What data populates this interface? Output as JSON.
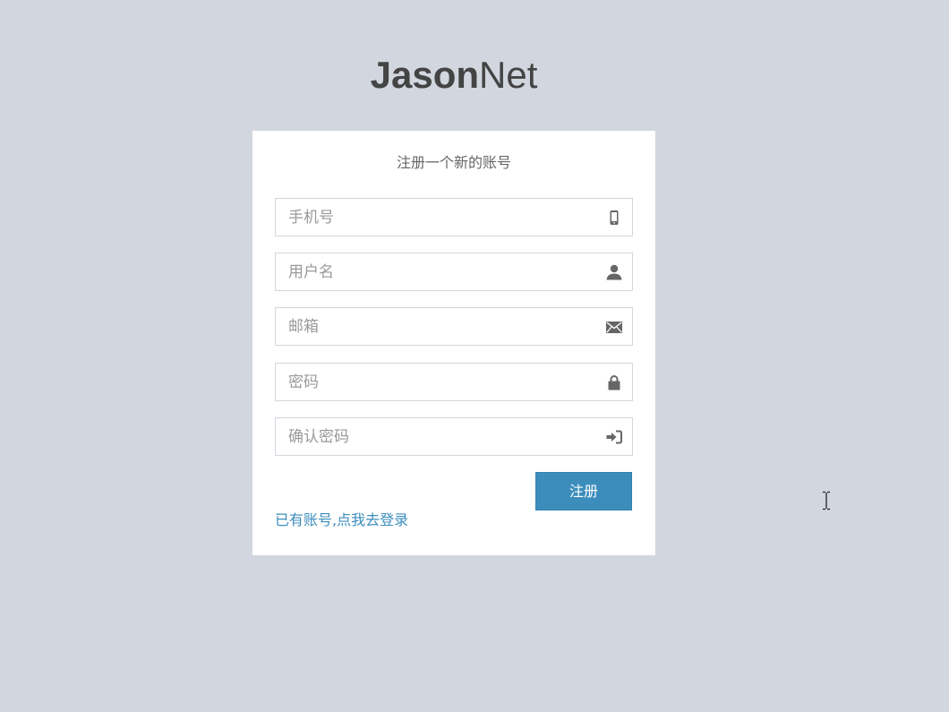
{
  "logo": {
    "bold": "Jason",
    "light": "Net"
  },
  "form": {
    "title": "注册一个新的账号",
    "fields": [
      {
        "placeholder": "手机号",
        "icon": "mobile-icon"
      },
      {
        "placeholder": "用户名",
        "icon": "user-icon"
      },
      {
        "placeholder": "邮箱",
        "icon": "envelope-icon"
      },
      {
        "placeholder": "密码",
        "icon": "lock-icon"
      },
      {
        "placeholder": "确认密码",
        "icon": "sign-in-icon"
      }
    ],
    "submit_label": "注册",
    "login_link": "已有账号,点我去登录"
  },
  "colors": {
    "background": "#d2d6de",
    "primary": "#3c8dbc",
    "icon": "#666666"
  }
}
